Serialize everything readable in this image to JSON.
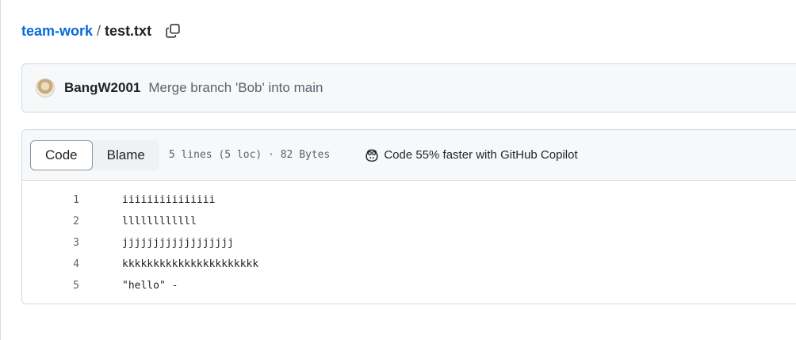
{
  "breadcrumb": {
    "repo": "team-work",
    "separator": "/",
    "file": "test.txt",
    "copy_icon": "copy-icon"
  },
  "commit": {
    "author": "BangW2001",
    "message": "Merge branch 'Bob' into main"
  },
  "file_header": {
    "tabs": [
      {
        "label": "Code",
        "selected": true
      },
      {
        "label": "Blame",
        "selected": false
      }
    ],
    "info": "5 lines (5 loc) · 82 Bytes",
    "copilot": {
      "icon": "copilot-icon",
      "label": "Code 55% faster with GitHub Copilot"
    }
  },
  "code_lines": [
    {
      "number": "1",
      "text": "iiiiiiiiiiiiiii"
    },
    {
      "number": "2",
      "text": "llllllllllll"
    },
    {
      "number": "3",
      "text": "jjjjjjjjjjjjjjjjjj"
    },
    {
      "number": "4",
      "text": "kkkkkkkkkkkkkkkkkkkkkk"
    },
    {
      "number": "5",
      "text": "\"hello\" -"
    }
  ],
  "colors": {
    "link": "#0969da",
    "muted": "#59636e",
    "border": "#d1d9e0",
    "header_bg": "#f6f8fa"
  }
}
